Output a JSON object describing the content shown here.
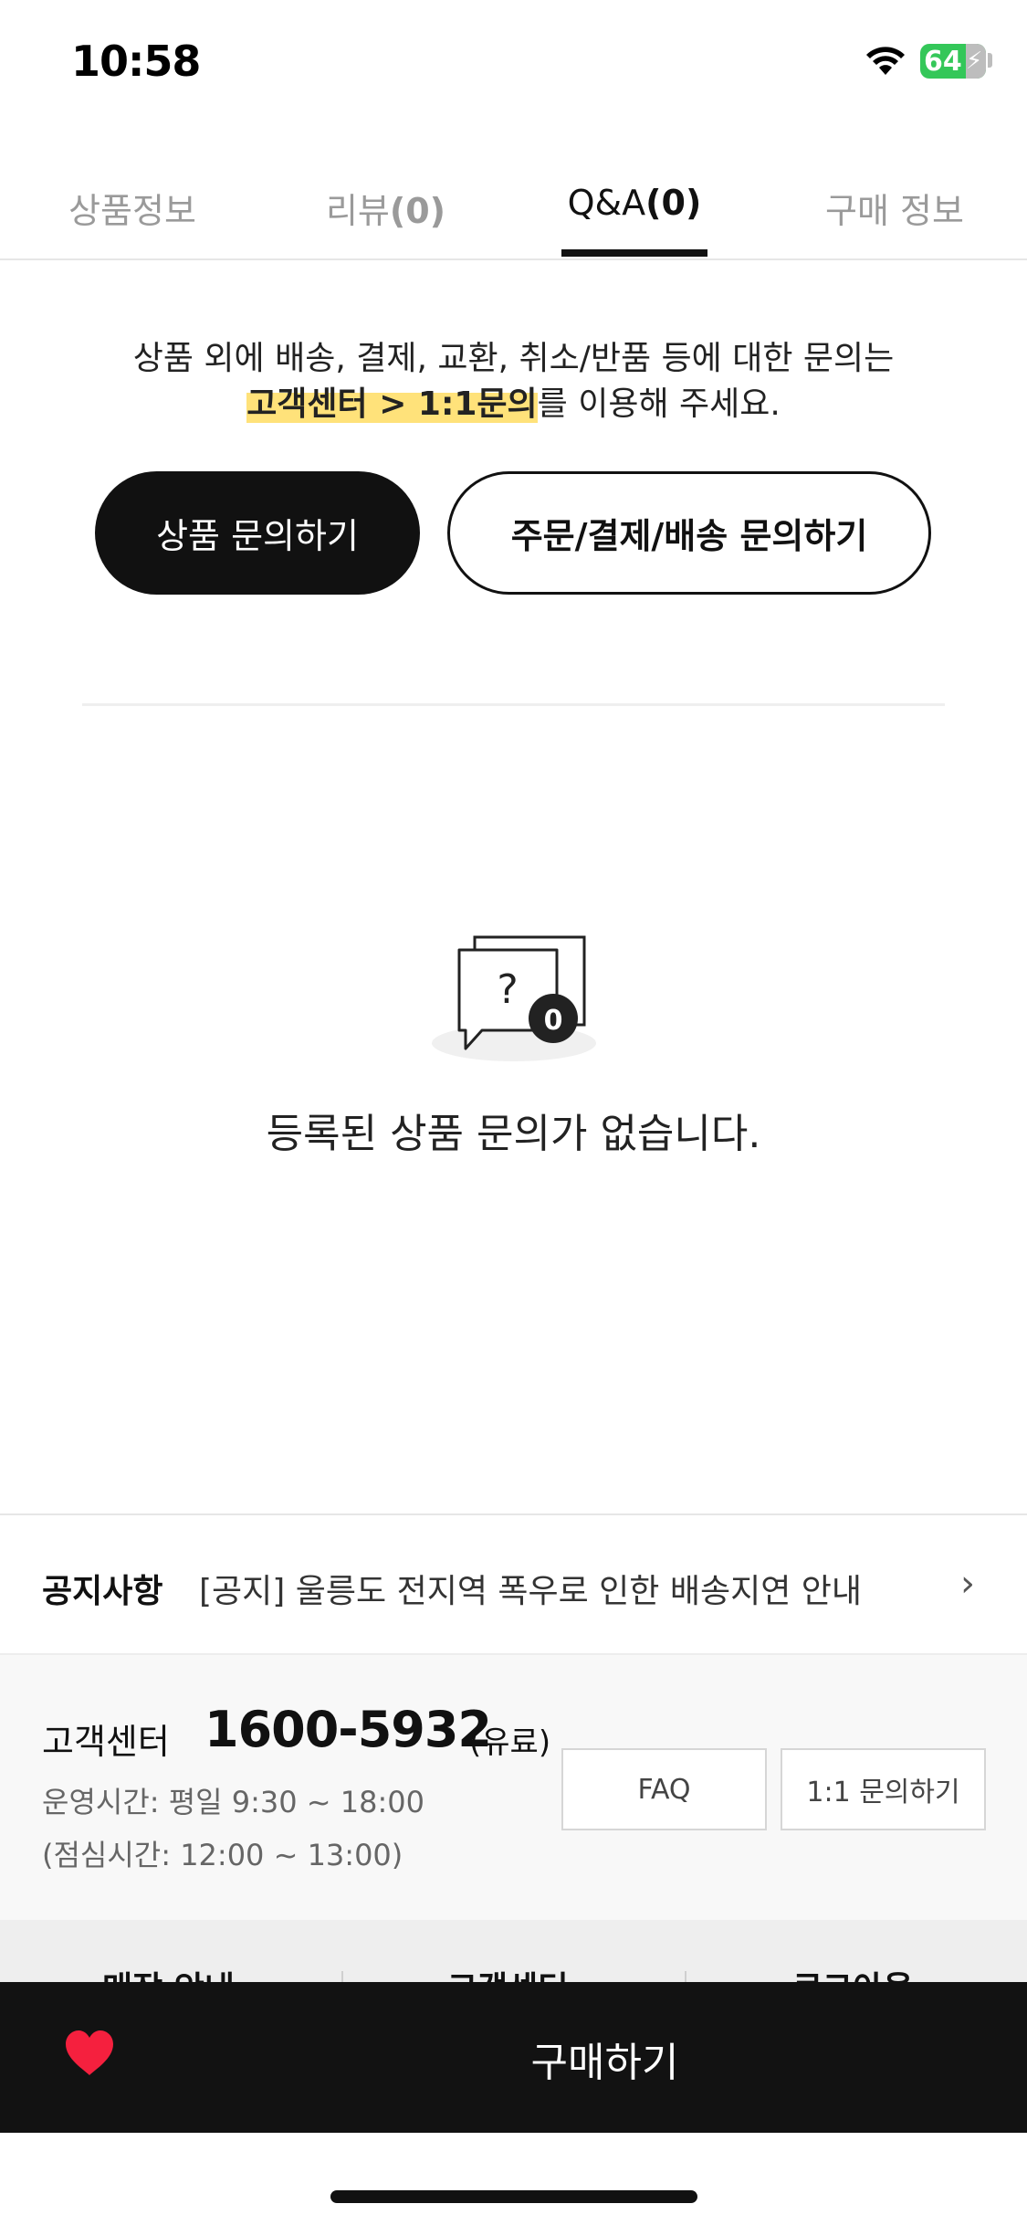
{
  "status_bar": {
    "time": "10:58",
    "battery": "64"
  },
  "tabs": [
    {
      "label": "상품정보",
      "count": ""
    },
    {
      "label": "리뷰",
      "count": "(0)"
    },
    {
      "label": "Q&A",
      "count": "(0)"
    },
    {
      "label": "구매 정보",
      "count": ""
    }
  ],
  "info": {
    "line1": "상품 외에 배송, 결제, 교환, 취소/반품 등에 대한 문의는",
    "highlight": "고객센터 > 1:1문의",
    "line2_rest": "를 이용해 주세요."
  },
  "buttons": {
    "product_inquiry": "상품 문의하기",
    "order_inquiry": "주문/결제/배송 문의하기"
  },
  "empty_state": {
    "icon_count": "0",
    "icon_symbol": "?",
    "message": "등록된 상품 문의가 없습니다."
  },
  "notice": {
    "label": "공지사항",
    "text": "[공지] 울릉도 전지역 폭우로 인한 배송지연 안내"
  },
  "customer_center": {
    "label": "고객센터",
    "phone": "1600-5932",
    "paid": "(유료)",
    "hours": "운영시간: 평일 9:30 ~ 18:00",
    "lunch": "(점심시간: 12:00 ~ 13:00)",
    "faq": "FAQ",
    "inquiry": "1:1 문의하기"
  },
  "footer_links": [
    "매장 안내",
    "고객센터",
    "로그아웃"
  ],
  "bottom_bar": {
    "buy": "구매하기"
  },
  "colors": {
    "accent_dark": "#111111",
    "highlight": "#ffe27a",
    "heart": "#f5203e",
    "battery": "#34c759"
  }
}
